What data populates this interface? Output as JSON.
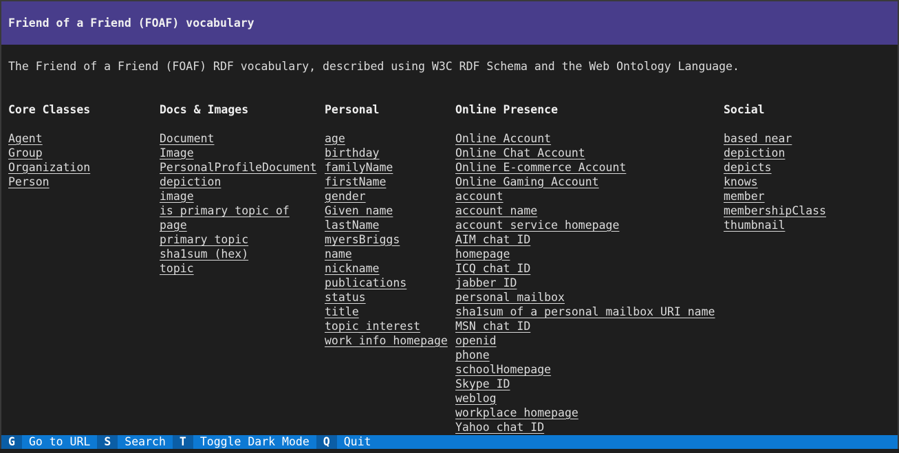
{
  "title": "Friend of a Friend (FOAF) vocabulary",
  "description": "The Friend of a Friend (FOAF) RDF vocabulary, described using W3C RDF Schema and the Web Ontology Language.",
  "columns": [
    {
      "heading": "Core Classes",
      "items": [
        "Agent",
        "Group",
        "Organization",
        "Person"
      ]
    },
    {
      "heading": "Docs & Images",
      "items": [
        "Document",
        "Image",
        "PersonalProfileDocument",
        "depiction",
        "image",
        "is primary topic of",
        "page",
        "primary topic",
        "sha1sum (hex)",
        "topic"
      ]
    },
    {
      "heading": "Personal",
      "items": [
        "age",
        "birthday",
        "familyName",
        "firstName",
        "gender",
        "Given name",
        "lastName",
        "myersBriggs",
        "name",
        "nickname",
        "publications",
        "status",
        "title",
        "topic_interest",
        "work info homepage"
      ]
    },
    {
      "heading": "Online Presence",
      "items": [
        "Online Account",
        "Online Chat Account",
        "Online E-commerce Account",
        "Online Gaming Account",
        "account",
        "account name",
        "account service homepage",
        "AIM chat ID",
        "homepage",
        "ICQ chat ID",
        "jabber ID",
        "personal mailbox",
        "sha1sum of a personal mailbox URI name",
        "MSN chat ID",
        "openid",
        "phone",
        "schoolHomepage",
        "Skype ID",
        "weblog",
        "workplace homepage",
        "Yahoo chat ID"
      ]
    },
    {
      "heading": "Social",
      "items": [
        "based near",
        "depiction",
        "depicts",
        "knows",
        "member",
        "membershipClass",
        "thumbnail"
      ]
    }
  ],
  "statusbar": [
    {
      "key": "G",
      "label": "Go to URL"
    },
    {
      "key": "S",
      "label": "Search"
    },
    {
      "key": "T",
      "label": "Toggle Dark Mode"
    },
    {
      "key": "Q",
      "label": "Quit"
    }
  ],
  "colors": {
    "title_bg": "#483d8b",
    "body_bg": "#1e1e1e",
    "text": "#dcdcdc",
    "statusbar_bg": "#0d79d3",
    "statusbar_key_bg": "#0b5ea6"
  }
}
